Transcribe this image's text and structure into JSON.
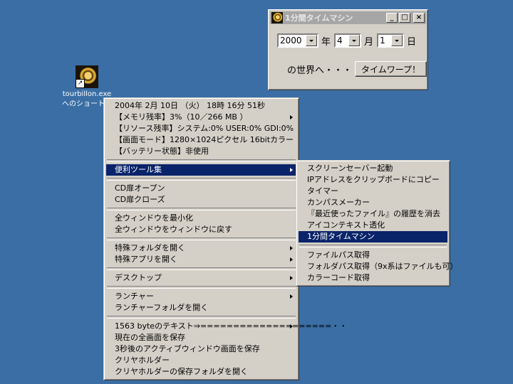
{
  "desktop": {
    "icon": {
      "name": "tourbillon-icon",
      "label_line1": "tourbillon.exe",
      "label_line2": "へのショートカ"
    }
  },
  "window": {
    "title": "1分間タイムマシン",
    "minimize": "_",
    "maximize": "□",
    "close": "×",
    "year_value": "2000",
    "year_unit": "年",
    "month_value": "4",
    "month_unit": "月",
    "day_value": "1",
    "day_unit": "日",
    "prompt": "の世界へ・・・",
    "warp_button": "タイムワープ！"
  },
  "main_menu": {
    "info": [
      "2004年 2月 10日 （火） 18時 16分 51秒",
      "【メモリ残率】3%（10／266 MB ）",
      "【リソース残率】システム:0%  USER:0%  GDI:0%",
      "【画面モード】1280×1024ピクセル  16bitカラー",
      "【バッテリー状態】非使用"
    ],
    "tools": "便利ツール集",
    "cd_open": "CD扉オープン",
    "cd_close": "CD扉クローズ",
    "minimize_all": "全ウィンドウを最小化",
    "restore_all": "全ウィンドウをウィンドウに戻す",
    "special_folder": "特殊フォルダを開く",
    "special_app": "特殊アプリを開く",
    "desktop": "デスクトップ",
    "launcher": "ランチャー",
    "launcher_folder": "ランチャーフォルダを開く",
    "clipboard_text": "1563 byteのテキスト⇒====================・・",
    "save_screen": "現在の全画面を保存",
    "save_active": "3秒後のアクティブウィンドウ画面を保存",
    "clear_holder": "クリヤホルダー",
    "open_holder_folder": "クリヤホルダーの保存フォルダを開く"
  },
  "tools_menu": {
    "screensaver": "スクリーンセーバー起動",
    "ip_copy": "IPアドレスをクリップボードにコピー",
    "timer": "タイマー",
    "calendar": "カンパスメーカー",
    "recent_files": "『最近使ったファイル』の履歴を消去",
    "icon_text": "アイコンテキスト透化",
    "time_machine": "1分間タイムマシン",
    "file_path": "ファイルパス取得",
    "folder_path": "フォルダパス取得（9x系はファイルも可）",
    "color_code": "カラーコード取得"
  }
}
